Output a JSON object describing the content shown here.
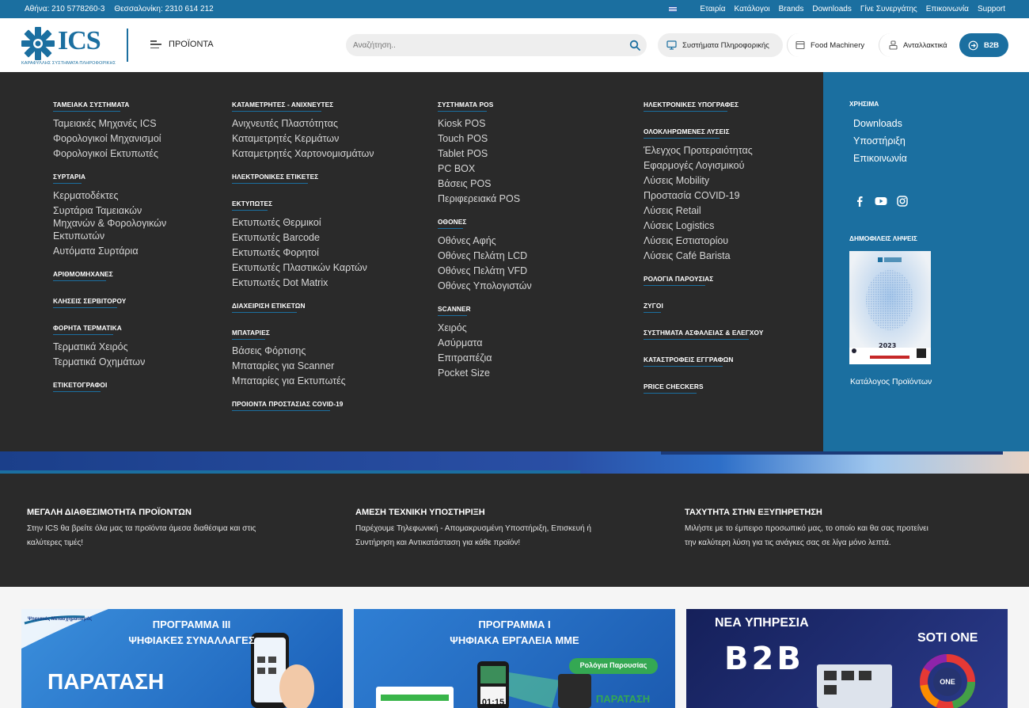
{
  "topbar": {
    "phone_athens": "Αθήνα: 210 5778260-3",
    "phone_thess": "Θεσσαλονίκη: 2310 614 212",
    "links": [
      "Εταιρία",
      "Κατάλογοι",
      "Brands",
      "Downloads",
      "Γίνε Συνεργάτης",
      "Επικοινωνία",
      "Support"
    ]
  },
  "header": {
    "logo_text": "ICS",
    "logo_tagline": "ΚΑΡΑΦΥΛΛΗΣ ΣΥΣΤΗΜΑΤΑ ΠΛΗΡΟΦΟΡΙΚΗΣ",
    "products_label": "ΠΡΟΪΟΝΤΑ",
    "search_placeholder": "Αναζήτηση..",
    "systems_label": "Συστήματα Πληροφορικής",
    "food_label": "Food Machinery",
    "spare_label": "Ανταλλακτικά",
    "b2b_label": "B2B"
  },
  "menu": {
    "col1": {
      "cat1": "ΤΑΜΕΙΑΚΑ ΣΥΣΤΗΜΑΤΑ",
      "cat1_items": [
        "Ταμειακές Μηχανές ICS",
        "Φορολογικοί Μηχανισμοί",
        "Φορολογικοί Εκτυπωτές"
      ],
      "cat2": "ΣΥΡΤΑΡΙΑ",
      "cat2_items": [
        "Κερματοδέκτες",
        "Συρτάρια Ταμειακών",
        "Μηχανών & Φορολογικών",
        "Εκτυπωτών",
        "Αυτόματα Συρτάρια"
      ],
      "cat3": "ΑΡΙΘΜΟΜΗΧΑΝΕΣ",
      "cat4": "ΚΛΗΣΕΙΣ ΣΕΡΒΙΤΟΡΟΥ",
      "cat5": "ΦΟΡΗΤΑ ΤΕΡΜΑΤΙΚΑ",
      "cat5_items": [
        "Τερματικά Χειρός",
        "Τερματικά Οχημάτων"
      ],
      "cat6": "ΕΤΙΚΕΤΟΓΡΑΦΟΙ"
    },
    "col2": {
      "cat1": "ΚΑΤΑΜΕΤΡΗΤΕΣ - ΑΝΙΧΝΕΥΤΕΣ",
      "cat1_items": [
        "Ανιχνευτές Πλαστότητας",
        "Καταμετρητές Κερμάτων",
        "Καταμετρητές Χαρτονομισμάτων"
      ],
      "cat2": "ΗΛΕΚΤΡΟΝΙΚΕΣ ΕΤΙΚΕΤΕΣ",
      "cat3": "ΕΚΤΥΠΩΤΕΣ",
      "cat3_items": [
        "Εκτυπωτές Θερμικοί",
        "Εκτυπωτές Barcode",
        "Εκτυπωτές Φορητοί",
        "Εκτυπωτές Πλαστικών Καρτών",
        "Εκτυπωτές Dot Matrix"
      ],
      "cat4": "ΔΙΑΧΕΙΡΙΣΗ ΕΤΙΚΕΤΩΝ",
      "cat5": "ΜΠΑΤΑΡΙΕΣ",
      "cat5_items": [
        "Βάσεις Φόρτισης",
        "Μπαταρίες για Scanner",
        "Μπαταρίες για Εκτυπωτές"
      ],
      "cat6": "ΠΡΟΙΟΝΤΑ ΠΡΟΣΤΑΣΙΑΣ COVID-19"
    },
    "col3": {
      "cat1": "ΣΥΣΤΗΜΑΤΑ POS",
      "cat1_items": [
        "Kiosk POS",
        "Touch POS",
        "Tablet POS",
        "PC BOX",
        "Βάσεις POS",
        "Περιφερειακά POS"
      ],
      "cat2": "ΟΘΟΝΕΣ",
      "cat2_items": [
        "Οθόνες Αφής",
        "Οθόνες Πελάτη LCD",
        "Οθόνες Πελάτη VFD",
        "Οθόνες Υπολογιστών"
      ],
      "cat3": "SCANNER",
      "cat3_items": [
        "Χειρός",
        "Ασύρματα",
        "Επιτραπέζια",
        "Pocket Size"
      ]
    },
    "col4": {
      "cat1": "ΗΛΕΚΤΡΟΝΙΚΕΣ ΥΠΟΓΡΑΦΕΣ",
      "cat2": "ΟΛΟΚΛΗΡΩΜΕΝΕΣ ΛΥΣΕΙΣ",
      "cat2_items": [
        "Έλεγχος Προτεραιότητας",
        "Εφαρμογές Λογισμικού",
        "Λύσεις Mobility",
        "Προστασία COVID-19",
        "Λύσεις Retail",
        "Λύσεις Logistics",
        "Λύσεις Εστιατορίου",
        "Λύσεις Café Barista"
      ],
      "cat3": "ΡΟΛΟΓΙΑ ΠΑΡΟΥΣΙΑΣ",
      "cat4": "ΖΥΓΟΙ",
      "cat5": "ΣΥΣΤΗΜΑΤΑ ΑΣΦΑΛΕΙΑΣ & ΕΛΕΓΧΟΥ",
      "cat6": "ΚΑΤΑΣΤΡΟΦΕΙΣ ΕΓΓΡΑΦΩΝ",
      "cat7": "PRICE CHECKERS"
    }
  },
  "side": {
    "useful_title": "ΧΡΗΣΙΜΑ",
    "links": [
      "Downloads",
      "Υποστήριξη",
      "Επικοινωνία"
    ],
    "popular_title": "ΔΗΜΟΦΙΛΕΙΣ ΛΗΨΕΙΣ",
    "catalog_year": "2023",
    "catalog_caption": "Κατάλογος Προϊόντων"
  },
  "features": [
    {
      "title": "ΜΕΓΑΛΗ ΔΙΑΘΕΣΙΜΟΤΗΤΑ ΠΡΟΪΟΝΤΩΝ",
      "line1": "Στην ICS θα βρείτε όλα μας τα προϊόντα άμεσα διαθέσιμα και στις",
      "line2": "καλύτερες τιμές!"
    },
    {
      "title": "ΑΜΕΣΗ ΤΕΧΝΙΚΗ ΥΠΟΣΤΗΡΙΞΗ",
      "line1": "Παρέχουμε Τηλεφωνική - Απομακρυσμένη Υποστήριξη, Επισκευή ή",
      "line2": "Συντήρηση και Αντικατάσταση για κάθε προϊόν!"
    },
    {
      "title": "ΤΑΧΥΤΗΤΑ ΣΤΗΝ ΕΞΥΠΗΡΕΤΗΣΗ",
      "line1": "Μιλήστε με το έμπειρο προσωπικό μας, το οποίο και θα σας προτείνει",
      "line2": "την καλύτερη λύση για τις ανάγκες σας σε λίγα μόνο λεπτά."
    }
  ],
  "banners": {
    "b1_small": "Ψηφιακός Μετασχηματισμός",
    "b1_line1": "ΠΡΟΓΡΑΜΜΑ ΙΙΙ",
    "b1_line2": "ΨΗΦΙΑΚΕΣ ΣΥΝΑΛΛΑΓΕΣ",
    "b1_big": "ΠΑΡΑΤΑΣΗ",
    "b2_line1": "ΠΡΟΓΡΑΜΜΑ Ι",
    "b2_line2": "ΨΗΦΙΑΚΑ ΕΡΓΑΛΕΙΑ ΜΜΕ",
    "b2_tag": "Ρολόγια Παρουσίας",
    "b2_clock": "01:15",
    "b2_big": "ΠΑΡΑΤΑΣΗ",
    "b3_line1": "ΝΕΑ ΥΠΗΡΕΣΙΑ",
    "b3_big": "B2B",
    "b3_right": "SOTI ONE",
    "b3_ring_center": "ONE"
  },
  "colors": {
    "brand": "#1b6fa0",
    "dark": "#2a2a2a"
  }
}
